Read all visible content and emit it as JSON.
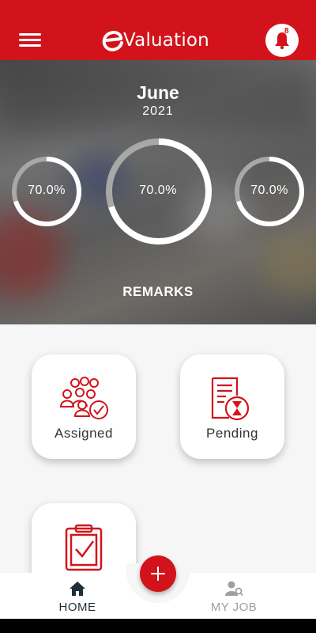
{
  "app": {
    "title": "Valuation",
    "notification_count": "8"
  },
  "hero": {
    "month": "June",
    "year": "2021",
    "rings": [
      {
        "label": "70.0%",
        "value": 0.7
      },
      {
        "label": "70.0%",
        "value": 0.7
      },
      {
        "label": "70.0%",
        "value": 0.7
      }
    ],
    "remarks_label": "REMARKS"
  },
  "cards": [
    {
      "label": "Assigned",
      "icon": "people-check-icon"
    },
    {
      "label": "Pending",
      "icon": "document-hourglass-icon"
    },
    {
      "label": "",
      "icon": "clipboard-check-icon"
    }
  ],
  "bottom_nav": {
    "home_label": "HOME",
    "myjob_label": "MY JOB"
  },
  "colors": {
    "accent": "#d3131b",
    "ring_track": "#a8a8a8",
    "ring_fill": "#ffffff"
  }
}
